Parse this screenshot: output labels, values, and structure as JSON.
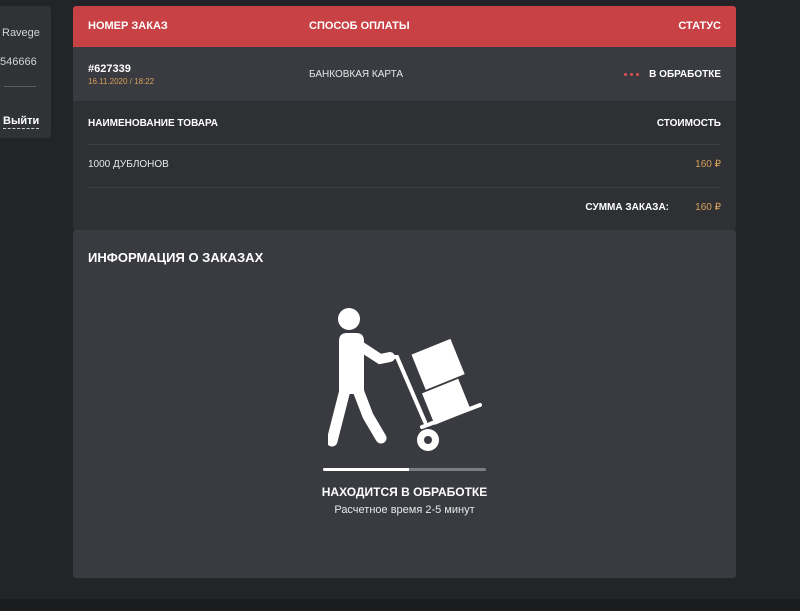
{
  "user": {
    "name": "Ravege",
    "id": "546666",
    "logout_label": "Выйти"
  },
  "order_table": {
    "headers": {
      "order_number": "НОМЕР ЗАКАЗ",
      "payment_method": "СПОСОБ ОПЛАТЫ",
      "status": "СТАТУС"
    },
    "order": {
      "number": "#627339",
      "date": "16.11.2020 / 18:22",
      "payment": "БАНКОВКАЯ КАРТА",
      "status": "В ОБРАБОТКЕ"
    },
    "items_headers": {
      "name": "НАИМЕНОВАНИЕ ТОВАРА",
      "price": "СТОИМОСТЬ"
    },
    "items": [
      {
        "name": "1000 ДУБЛОНОВ",
        "price": "160 ₽"
      }
    ],
    "total": {
      "label": "СУММА ЗАКАЗА:",
      "value": "160 ₽"
    }
  },
  "info": {
    "title": "ИНФОРМАЦИЯ О ЗАКАЗАХ",
    "illustration_icon": "delivery-person-hand-truck-icon",
    "progress_fraction": 0.53,
    "processing_title": "НАХОДИТСЯ В ОБРАБОТКЕ",
    "processing_subtitle": "Расчетное время 2-5 минут"
  },
  "colors": {
    "accent_red": "#c84144",
    "price_gold": "#d7a15b",
    "background": "#222427"
  }
}
